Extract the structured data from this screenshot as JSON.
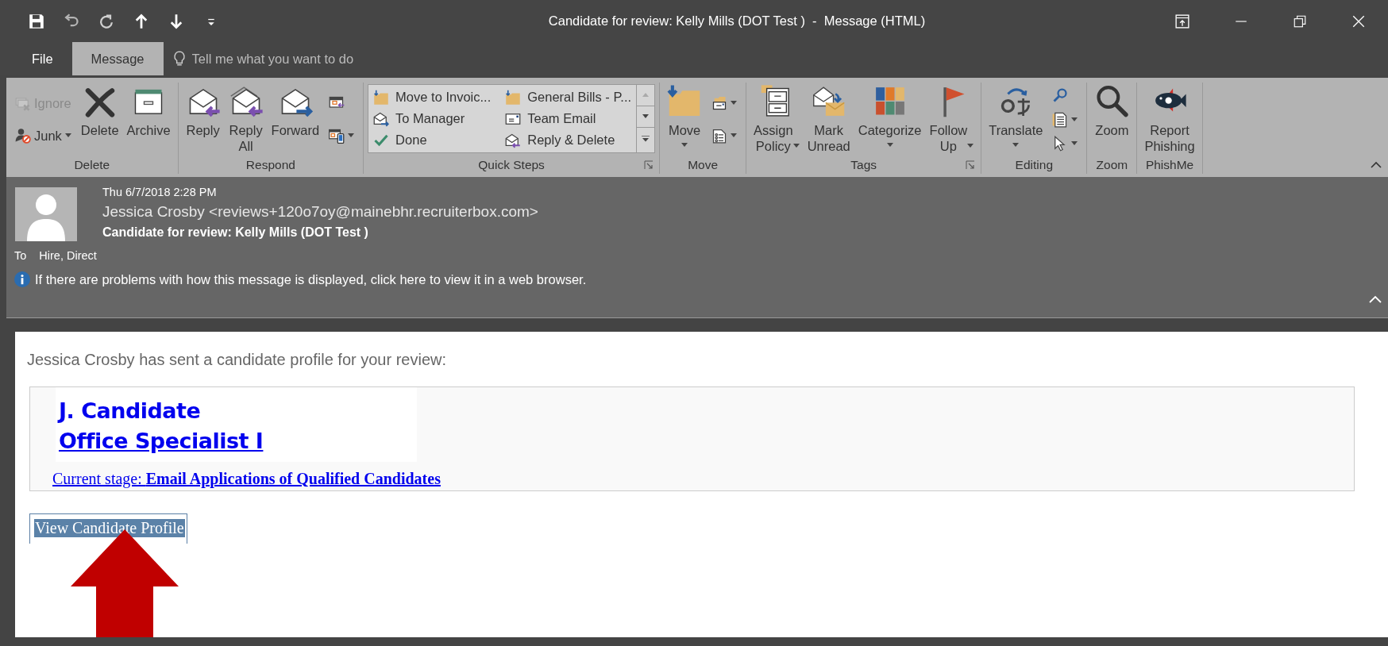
{
  "window": {
    "title": "Candidate for review: Kelly Mills (DOT Test )  -  Message (HTML)"
  },
  "menu_tabs": [
    {
      "label": "File",
      "selected": false
    },
    {
      "label": "Message",
      "selected": true
    }
  ],
  "tell_me": {
    "placeholder": "Tell me what you want to do"
  },
  "ribbon": {
    "groups": [
      {
        "label": "Delete",
        "launcher": false,
        "items": [
          {
            "kind": "small",
            "label": "Ignore",
            "dropdown": false,
            "disabled": true
          },
          {
            "kind": "small",
            "label": "Junk",
            "dropdown": true,
            "disabled": false
          },
          {
            "kind": "large",
            "label": "Delete",
            "dropdown": false,
            "disabled": false
          },
          {
            "kind": "large",
            "label": "Archive",
            "dropdown": false,
            "disabled": false
          }
        ]
      },
      {
        "label": "Respond",
        "launcher": false,
        "items": [
          {
            "kind": "large",
            "label": "Reply",
            "dropdown": false,
            "disabled": false
          },
          {
            "kind": "large",
            "label": "Reply All",
            "dropdown": false,
            "disabled": false,
            "wrap": true
          },
          {
            "kind": "large",
            "label": "Forward",
            "dropdown": false,
            "disabled": false
          },
          {
            "kind": "icon",
            "dropdown": false,
            "disabled": false
          },
          {
            "kind": "icon",
            "dropdown": true,
            "disabled": false
          }
        ]
      },
      {
        "label": "Quick Steps",
        "launcher": true,
        "items": [
          {
            "kind": "gallery",
            "steps": [
              {
                "label": "Move to Invoic..."
              },
              {
                "label": "General Bills - P..."
              },
              {
                "label": "To Manager"
              },
              {
                "label": "Team Email"
              },
              {
                "label": "Done"
              },
              {
                "label": "Reply & Delete"
              }
            ]
          }
        ]
      },
      {
        "label": "Move",
        "launcher": false,
        "items": [
          {
            "kind": "large",
            "label": "Move",
            "dropdown": true,
            "disabled": false
          },
          {
            "kind": "icon",
            "dropdown": true,
            "disabled": false
          },
          {
            "kind": "icon",
            "dropdown": true,
            "disabled": false
          }
        ]
      },
      {
        "label": "Tags",
        "launcher": true,
        "items": [
          {
            "kind": "large",
            "label": "Assign Policy",
            "dropdown": true,
            "disabled": false,
            "wrap": true
          },
          {
            "kind": "large",
            "label": "Mark Unread",
            "dropdown": false,
            "disabled": false,
            "wrap": true
          },
          {
            "kind": "large",
            "label": "Categorize",
            "dropdown": true,
            "disabled": false
          },
          {
            "kind": "large",
            "label": "Follow Up",
            "dropdown": true,
            "disabled": false,
            "wrap": true
          }
        ]
      },
      {
        "label": "Editing",
        "launcher": false,
        "items": [
          {
            "kind": "large",
            "label": "Translate",
            "dropdown": true,
            "disabled": false
          },
          {
            "kind": "icon",
            "dropdown": false,
            "disabled": false
          },
          {
            "kind": "icon",
            "dropdown": true,
            "disabled": false
          },
          {
            "kind": "icon",
            "dropdown": true,
            "disabled": false
          }
        ]
      },
      {
        "label": "Zoom",
        "launcher": false,
        "items": [
          {
            "kind": "large",
            "label": "Zoom",
            "dropdown": false,
            "disabled": false
          }
        ]
      },
      {
        "label": "PhishMe",
        "launcher": false,
        "items": [
          {
            "kind": "large",
            "label": "Report Phishing",
            "dropdown": false,
            "disabled": false,
            "wrap": true
          }
        ]
      }
    ]
  },
  "header": {
    "date": "Thu 6/7/2018 2:28 PM",
    "sender": "Jessica Crosby <reviews+120o7oy@mainebhr.recruiterbox.com>",
    "subject": "Candidate for review: Kelly Mills (DOT Test )",
    "to_label": "To",
    "to": "Hire, Direct",
    "info": "If there are problems with how this message is displayed, click here to view it in a web browser."
  },
  "message": {
    "intro": "Jessica Crosby has sent a candidate profile for your review:",
    "candidate_name": "J. Candidate",
    "position": "Office Specialist I",
    "stage": "Current stage: **Email Applications of Qualified Candidates**",
    "button": "View Candidate Profile"
  }
}
